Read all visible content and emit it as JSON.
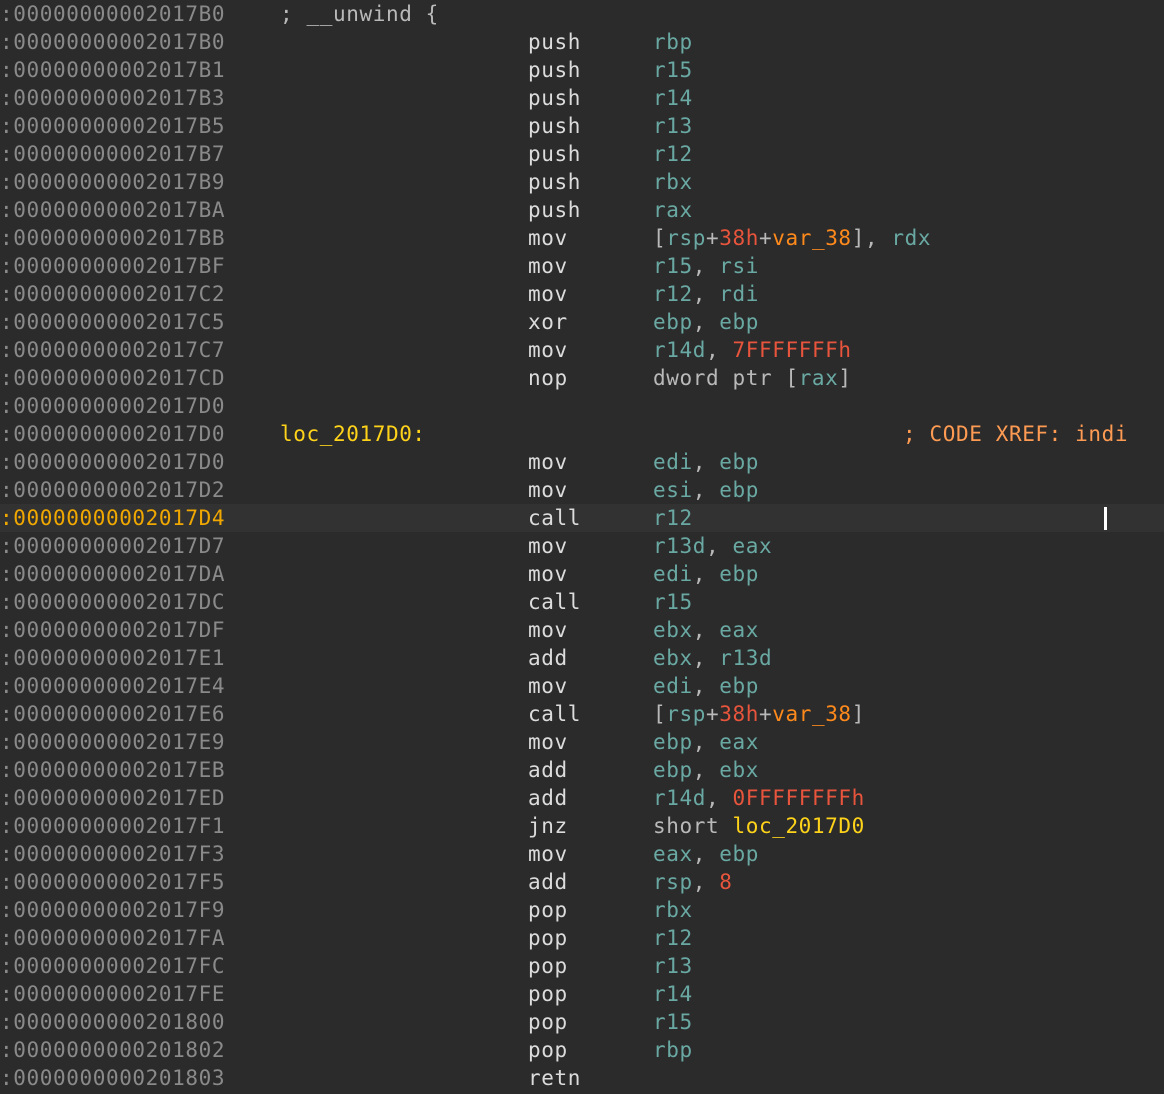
{
  "header": {
    "address": ":00000000002017B0",
    "comment": "; __unwind {"
  },
  "label_line": {
    "address": ":00000000002017D0",
    "label": "loc_2017D0:",
    "xref": "; CODE XREF: indi"
  },
  "current_address": ":00000000002017D4",
  "instructions": [
    {
      "address": ":00000000002017B0",
      "mnemonic": "push",
      "operands": [
        {
          "text": "rbp",
          "kind": "reg"
        }
      ]
    },
    {
      "address": ":00000000002017B1",
      "mnemonic": "push",
      "operands": [
        {
          "text": "r15",
          "kind": "reg"
        }
      ]
    },
    {
      "address": ":00000000002017B3",
      "mnemonic": "push",
      "operands": [
        {
          "text": "r14",
          "kind": "reg"
        }
      ]
    },
    {
      "address": ":00000000002017B5",
      "mnemonic": "push",
      "operands": [
        {
          "text": "r13",
          "kind": "reg"
        }
      ]
    },
    {
      "address": ":00000000002017B7",
      "mnemonic": "push",
      "operands": [
        {
          "text": "r12",
          "kind": "reg"
        }
      ]
    },
    {
      "address": ":00000000002017B9",
      "mnemonic": "push",
      "operands": [
        {
          "text": "rbx",
          "kind": "reg"
        }
      ]
    },
    {
      "address": ":00000000002017BA",
      "mnemonic": "push",
      "operands": [
        {
          "text": "rax",
          "kind": "reg"
        }
      ]
    },
    {
      "address": ":00000000002017BB",
      "mnemonic": "mov",
      "operands": [
        {
          "text": "[",
          "kind": "txt"
        },
        {
          "text": "rsp",
          "kind": "reg"
        },
        {
          "text": "+",
          "kind": "txt"
        },
        {
          "text": "38h",
          "kind": "num"
        },
        {
          "text": "+",
          "kind": "txt"
        },
        {
          "text": "var_38",
          "kind": "var"
        },
        {
          "text": "], ",
          "kind": "txt"
        },
        {
          "text": "rdx",
          "kind": "reg"
        }
      ]
    },
    {
      "address": ":00000000002017BF",
      "mnemonic": "mov",
      "operands": [
        {
          "text": "r15",
          "kind": "reg"
        },
        {
          "text": ", ",
          "kind": "txt"
        },
        {
          "text": "rsi",
          "kind": "reg"
        }
      ]
    },
    {
      "address": ":00000000002017C2",
      "mnemonic": "mov",
      "operands": [
        {
          "text": "r12",
          "kind": "reg"
        },
        {
          "text": ", ",
          "kind": "txt"
        },
        {
          "text": "rdi",
          "kind": "reg"
        }
      ]
    },
    {
      "address": ":00000000002017C5",
      "mnemonic": "xor",
      "operands": [
        {
          "text": "ebp",
          "kind": "reg"
        },
        {
          "text": ", ",
          "kind": "txt"
        },
        {
          "text": "ebp",
          "kind": "reg"
        }
      ]
    },
    {
      "address": ":00000000002017C7",
      "mnemonic": "mov",
      "operands": [
        {
          "text": "r14d",
          "kind": "reg"
        },
        {
          "text": ", ",
          "kind": "txt"
        },
        {
          "text": "7FFFFFFFh",
          "kind": "num"
        }
      ]
    },
    {
      "address": ":00000000002017CD",
      "mnemonic": "nop",
      "operands": [
        {
          "text": "dword ptr [",
          "kind": "txt"
        },
        {
          "text": "rax",
          "kind": "reg"
        },
        {
          "text": "]",
          "kind": "txt"
        }
      ]
    },
    {
      "address": ":00000000002017D0",
      "mnemonic": "",
      "operands": []
    },
    {
      "label_line": true
    },
    {
      "address": ":00000000002017D0",
      "mnemonic": "mov",
      "operands": [
        {
          "text": "edi",
          "kind": "reg"
        },
        {
          "text": ", ",
          "kind": "txt"
        },
        {
          "text": "ebp",
          "kind": "reg"
        }
      ]
    },
    {
      "address": ":00000000002017D2",
      "mnemonic": "mov",
      "operands": [
        {
          "text": "esi",
          "kind": "reg"
        },
        {
          "text": ", ",
          "kind": "txt"
        },
        {
          "text": "ebp",
          "kind": "reg"
        }
      ]
    },
    {
      "address": ":00000000002017D4",
      "mnemonic": "call",
      "operands": [
        {
          "text": "r12",
          "kind": "reg"
        }
      ],
      "current": true
    },
    {
      "address": ":00000000002017D7",
      "mnemonic": "mov",
      "operands": [
        {
          "text": "r13d",
          "kind": "reg"
        },
        {
          "text": ", ",
          "kind": "txt"
        },
        {
          "text": "eax",
          "kind": "reg"
        }
      ]
    },
    {
      "address": ":00000000002017DA",
      "mnemonic": "mov",
      "operands": [
        {
          "text": "edi",
          "kind": "reg"
        },
        {
          "text": ", ",
          "kind": "txt"
        },
        {
          "text": "ebp",
          "kind": "reg"
        }
      ]
    },
    {
      "address": ":00000000002017DC",
      "mnemonic": "call",
      "operands": [
        {
          "text": "r15",
          "kind": "reg"
        }
      ]
    },
    {
      "address": ":00000000002017DF",
      "mnemonic": "mov",
      "operands": [
        {
          "text": "ebx",
          "kind": "reg"
        },
        {
          "text": ", ",
          "kind": "txt"
        },
        {
          "text": "eax",
          "kind": "reg"
        }
      ]
    },
    {
      "address": ":00000000002017E1",
      "mnemonic": "add",
      "operands": [
        {
          "text": "ebx",
          "kind": "reg"
        },
        {
          "text": ", ",
          "kind": "txt"
        },
        {
          "text": "r13d",
          "kind": "reg"
        }
      ]
    },
    {
      "address": ":00000000002017E4",
      "mnemonic": "mov",
      "operands": [
        {
          "text": "edi",
          "kind": "reg"
        },
        {
          "text": ", ",
          "kind": "txt"
        },
        {
          "text": "ebp",
          "kind": "reg"
        }
      ]
    },
    {
      "address": ":00000000002017E6",
      "mnemonic": "call",
      "operands": [
        {
          "text": "[",
          "kind": "txt"
        },
        {
          "text": "rsp",
          "kind": "reg"
        },
        {
          "text": "+",
          "kind": "txt"
        },
        {
          "text": "38h",
          "kind": "num"
        },
        {
          "text": "+",
          "kind": "txt"
        },
        {
          "text": "var_38",
          "kind": "var"
        },
        {
          "text": "]",
          "kind": "txt"
        }
      ]
    },
    {
      "address": ":00000000002017E9",
      "mnemonic": "mov",
      "operands": [
        {
          "text": "ebp",
          "kind": "reg"
        },
        {
          "text": ", ",
          "kind": "txt"
        },
        {
          "text": "eax",
          "kind": "reg"
        }
      ]
    },
    {
      "address": ":00000000002017EB",
      "mnemonic": "add",
      "operands": [
        {
          "text": "ebp",
          "kind": "reg"
        },
        {
          "text": ", ",
          "kind": "txt"
        },
        {
          "text": "ebx",
          "kind": "reg"
        }
      ]
    },
    {
      "address": ":00000000002017ED",
      "mnemonic": "add",
      "operands": [
        {
          "text": "r14d",
          "kind": "reg"
        },
        {
          "text": ", ",
          "kind": "txt"
        },
        {
          "text": "0FFFFFFFFh",
          "kind": "num"
        }
      ]
    },
    {
      "address": ":00000000002017F1",
      "mnemonic": "jnz",
      "operands": [
        {
          "text": "short ",
          "kind": "txt"
        },
        {
          "text": "loc_2017D0",
          "kind": "lbl"
        }
      ]
    },
    {
      "address": ":00000000002017F3",
      "mnemonic": "mov",
      "operands": [
        {
          "text": "eax",
          "kind": "reg"
        },
        {
          "text": ", ",
          "kind": "txt"
        },
        {
          "text": "ebp",
          "kind": "reg"
        }
      ]
    },
    {
      "address": ":00000000002017F5",
      "mnemonic": "add",
      "operands": [
        {
          "text": "rsp",
          "kind": "reg"
        },
        {
          "text": ", ",
          "kind": "txt"
        },
        {
          "text": "8",
          "kind": "num"
        }
      ]
    },
    {
      "address": ":00000000002017F9",
      "mnemonic": "pop",
      "operands": [
        {
          "text": "rbx",
          "kind": "reg"
        }
      ]
    },
    {
      "address": ":00000000002017FA",
      "mnemonic": "pop",
      "operands": [
        {
          "text": "r12",
          "kind": "reg"
        }
      ]
    },
    {
      "address": ":00000000002017FC",
      "mnemonic": "pop",
      "operands": [
        {
          "text": "r13",
          "kind": "reg"
        }
      ]
    },
    {
      "address": ":00000000002017FE",
      "mnemonic": "pop",
      "operands": [
        {
          "text": "r14",
          "kind": "reg"
        }
      ]
    },
    {
      "address": ":0000000000201800",
      "mnemonic": "pop",
      "operands": [
        {
          "text": "r15",
          "kind": "reg"
        }
      ]
    },
    {
      "address": ":0000000000201802",
      "mnemonic": "pop",
      "operands": [
        {
          "text": "rbp",
          "kind": "reg"
        }
      ]
    },
    {
      "address": ":0000000000201803",
      "mnemonic": "retn",
      "operands": []
    }
  ],
  "colors": {
    "background": "#2b2b2b",
    "current_line": "#323232",
    "address": "#8a8a8a",
    "current_address": "#f0a800",
    "register": "#6aa9a3",
    "number": "#e8553c",
    "variable": "#ff8a1c",
    "label": "#ffd31a",
    "xref": "#ff9b52",
    "mnemonic": "#dcdcdc"
  }
}
